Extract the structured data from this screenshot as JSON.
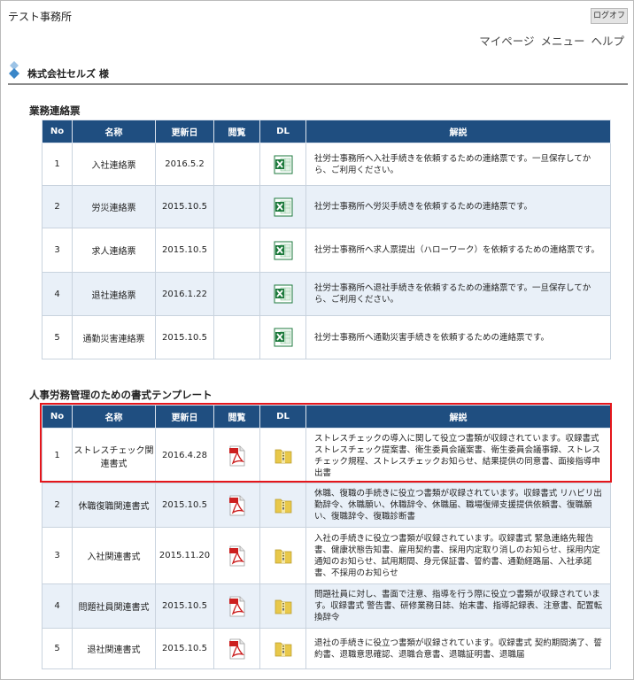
{
  "header": {
    "app_title": "テスト事務所",
    "logout_label": "ログオフ",
    "nav": [
      "マイページ",
      "メニュー",
      "ヘルプ"
    ]
  },
  "company": {
    "name": "株式会社セルズ 様"
  },
  "section1": {
    "title": "業務連絡票",
    "columns": [
      "No",
      "名称",
      "更新日",
      "閲覧",
      "DL",
      "解説"
    ],
    "rows": [
      {
        "no": "1",
        "name": "入社連絡票",
        "date": "2016.5.2",
        "view_icon": "",
        "dl_icon": "excel-icon",
        "desc": "社労士事務所へ入社手続きを依頼するための連絡票です。一旦保存してから、ご利用ください。"
      },
      {
        "no": "2",
        "name": "労災連絡票",
        "date": "2015.10.5",
        "view_icon": "",
        "dl_icon": "excel-icon",
        "desc": "社労士事務所へ労災手続きを依頼するための連絡票です。"
      },
      {
        "no": "3",
        "name": "求人連絡票",
        "date": "2015.10.5",
        "view_icon": "",
        "dl_icon": "excel-icon",
        "desc": "社労士事務所へ求人票提出（ハローワーク）を依頼するための連絡票です。"
      },
      {
        "no": "4",
        "name": "退社連絡票",
        "date": "2016.1.22",
        "view_icon": "",
        "dl_icon": "excel-icon",
        "desc": "社労士事務所へ退社手続きを依頼するための連絡票です。一旦保存してから、ご利用ください。"
      },
      {
        "no": "5",
        "name": "通勤災害連絡票",
        "date": "2015.10.5",
        "view_icon": "",
        "dl_icon": "excel-icon",
        "desc": "社労士事務所へ通勤災害手続きを依頼するための連絡票です。"
      }
    ]
  },
  "section2": {
    "title": "人事労務管理のための書式テンプレート",
    "columns": [
      "No",
      "名称",
      "更新日",
      "閲覧",
      "DL",
      "解説"
    ],
    "rows": [
      {
        "no": "1",
        "name": "ストレスチェック関連書式",
        "date": "2016.4.28",
        "view_icon": "pdf-icon",
        "dl_icon": "zip-icon",
        "desc": "ストレスチェックの導入に関して役立つ書類が収録されています。収録書式 ストレスチェック提案書、衛生委員会議案書、衛生委員会議事録、ストレスチェック規程、ストレスチェックお知らせ、結果提供の同意書、面接指導申出書"
      },
      {
        "no": "2",
        "name": "休職復職関連書式",
        "date": "2015.10.5",
        "view_icon": "pdf-icon",
        "dl_icon": "zip-icon",
        "desc": "休職、復職の手続きに役立つ書類が収録されています。収録書式 リハビリ出勤辞令、休職願い、休職辞令、休職届、職場復帰支援提供依頼書、復職願い、復職辞令、復職診断書"
      },
      {
        "no": "3",
        "name": "入社関連書式",
        "date": "2015.11.20",
        "view_icon": "pdf-icon",
        "dl_icon": "zip-icon",
        "desc": "入社の手続きに役立つ書類が収録されています。収録書式 緊急連絡先報告書、健康状態告知書、雇用契約書、採用内定取り消しのお知らせ、採用内定通知のお知らせ、試用期間、身元保証書、誓約書、通勤経路届、入社承諾書、不採用のお知らせ"
      },
      {
        "no": "4",
        "name": "問題社員関連書式",
        "date": "2015.10.5",
        "view_icon": "pdf-icon",
        "dl_icon": "zip-icon",
        "desc": "問題社員に対し、書面で注意、指導を行う際に役立つ書類が収録されています。収録書式 警告書、研修業務日誌、始末書、指導記録表、注意書、配置転換辞令"
      },
      {
        "no": "5",
        "name": "退社関連書式",
        "date": "2015.10.5",
        "view_icon": "pdf-icon",
        "dl_icon": "zip-icon",
        "desc": "退社の手続きに役立つ書類が収録されています。収録書式 契約期間満了、誓約書、退職意思確認、退職合意書、退職証明書、退職届"
      }
    ]
  },
  "colors": {
    "header_bg": "#1f4e80",
    "row_alt_bg": "#e9f0f8",
    "highlight_border": "#e5161b",
    "excel_green": "#1d7a3c",
    "pdf_red": "#cc1f1f",
    "zip_yellow": "#e8c84a"
  }
}
